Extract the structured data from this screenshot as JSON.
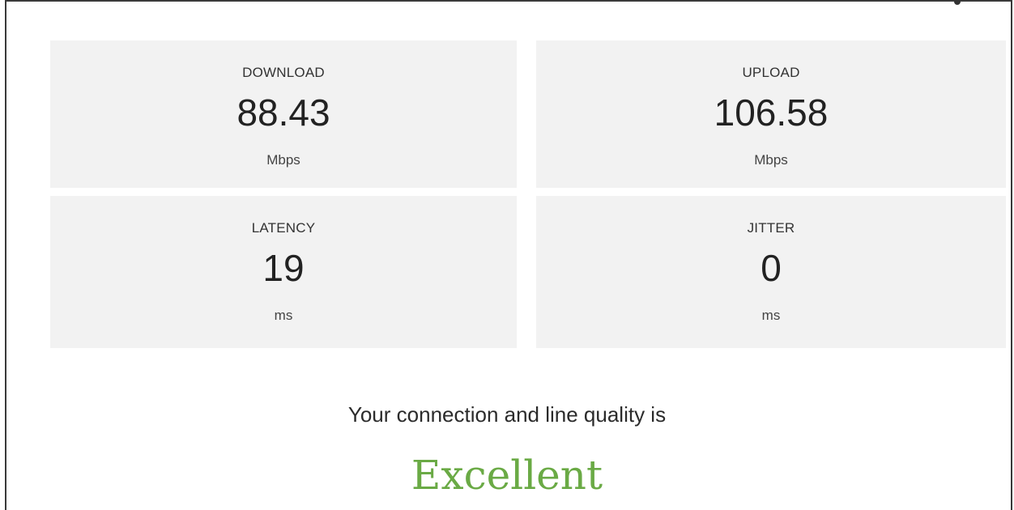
{
  "metrics": {
    "download": {
      "label": "DOWNLOAD",
      "value": "88.43",
      "unit": "Mbps"
    },
    "upload": {
      "label": "UPLOAD",
      "value": "106.58",
      "unit": "Mbps"
    },
    "latency": {
      "label": "LATENCY",
      "value": "19",
      "unit": "ms"
    },
    "jitter": {
      "label": "JITTER",
      "value": "0",
      "unit": "ms"
    }
  },
  "quality": {
    "intro": "Your connection and line quality is",
    "rating": "Excellent",
    "rating_color": "#6aaa45"
  },
  "colors": {
    "tile_background": "#f2f2f2",
    "text": "#2b2b2b"
  }
}
